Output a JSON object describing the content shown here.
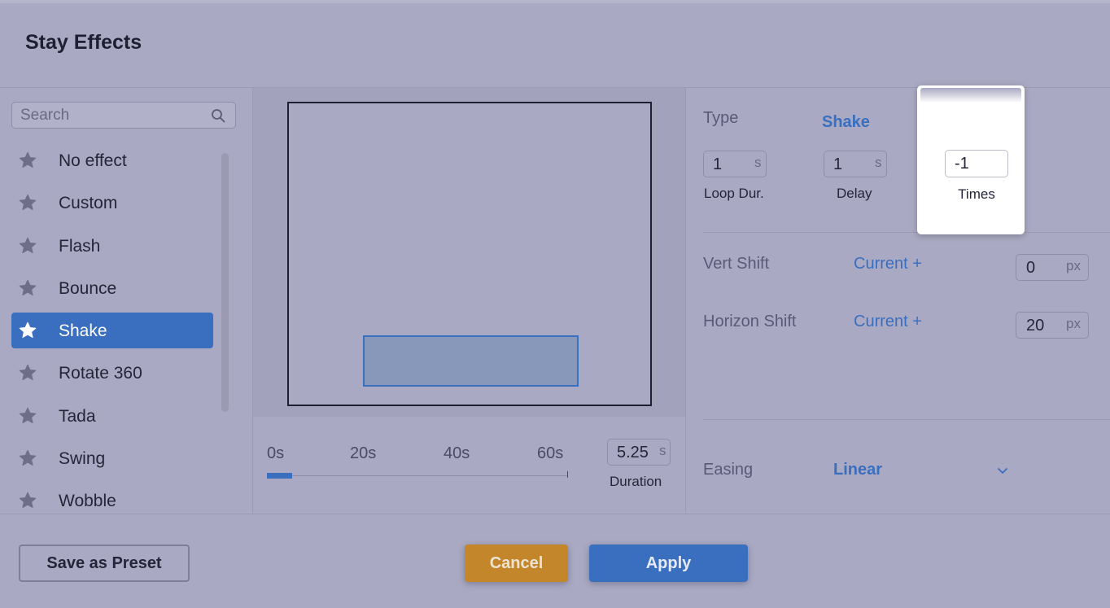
{
  "dialog": {
    "title": "Stay Effects"
  },
  "search": {
    "placeholder": "Search"
  },
  "effects": [
    {
      "label": "No effect"
    },
    {
      "label": "Custom"
    },
    {
      "label": "Flash"
    },
    {
      "label": "Bounce"
    },
    {
      "label": "Shake"
    },
    {
      "label": "Rotate 360"
    },
    {
      "label": "Tada"
    },
    {
      "label": "Swing"
    },
    {
      "label": "Wobble"
    }
  ],
  "selected_effect": "Shake",
  "timeline": {
    "ticks": [
      "0s",
      "20s",
      "40s",
      "60s"
    ],
    "progress_fraction": 0.085,
    "duration_value": "5.25",
    "duration_unit": "s",
    "duration_label": "Duration"
  },
  "settings": {
    "type_label": "Type",
    "type_value": "Shake",
    "loop_value": "1",
    "loop_unit": "s",
    "loop_label": "Loop Dur.",
    "delay_value": "1",
    "delay_unit": "s",
    "delay_label": "Delay",
    "times_value": "-1",
    "times_label": "Times",
    "vert_label": "Vert Shift",
    "vert_mode": "Current +",
    "vert_value": "0",
    "vert_unit": "px",
    "horiz_label": "Horizon Shift",
    "horiz_mode": "Current +",
    "horiz_value": "20",
    "horiz_unit": "px",
    "easing_label": "Easing",
    "easing_value": "Linear"
  },
  "footer": {
    "preset_label": "Save as Preset",
    "cancel_label": "Cancel",
    "apply_label": "Apply"
  },
  "colors": {
    "accent": "#3a6fc0",
    "cancel": "#c4862a",
    "background": "#a9a9c3"
  }
}
